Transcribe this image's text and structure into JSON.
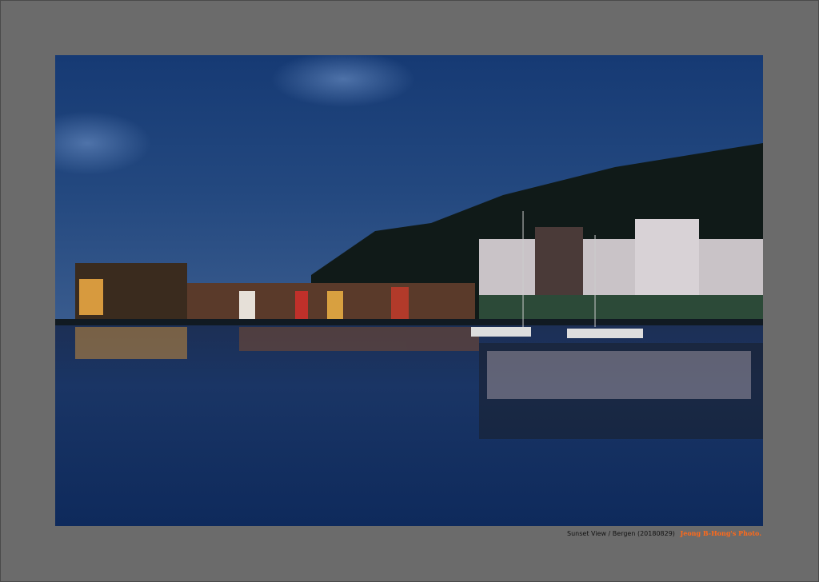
{
  "caption": {
    "title": "Sunset View / Bergen (20180829)",
    "credit": "Jeong B-Hong's Photo."
  },
  "colors": {
    "mat": "#6b6b6b",
    "credit": "#ff6a1a",
    "sky": "#1d3f7a",
    "water": "#0f2a5a"
  }
}
